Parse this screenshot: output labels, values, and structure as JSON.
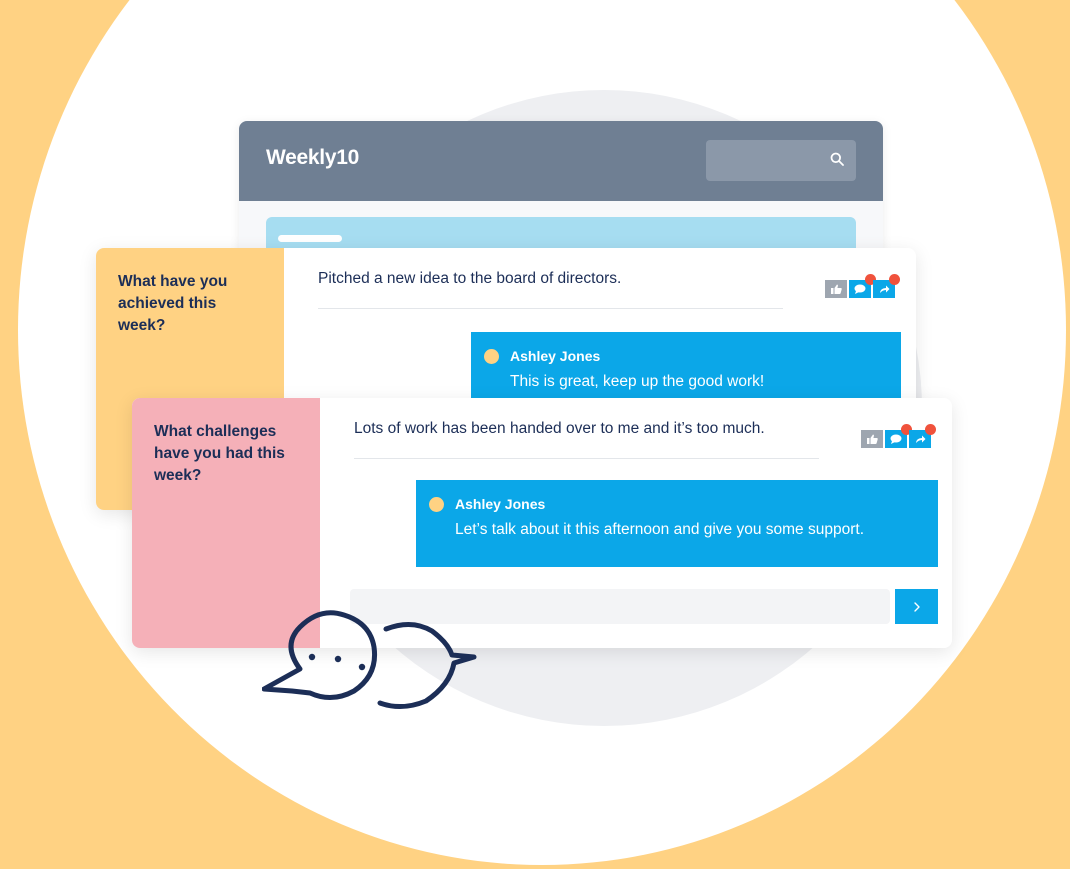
{
  "app": {
    "logo": "Weekly10",
    "search_icon": "search-icon"
  },
  "cards": [
    {
      "question": "What have you achieved this week?",
      "answer": "Pitched a new idea to the board of directors.",
      "reply": {
        "author": "Ashley Jones",
        "message": "This is great, keep up the good work!"
      }
    },
    {
      "question": "What challenges have you had this week?",
      "answer": "Lots of work has been handed over to me and it’s too much.",
      "reply": {
        "author": "Ashley Jones",
        "message": "Let’s talk about it this afternoon and give you some support."
      },
      "reply_input_placeholder": "",
      "send_icon": "chevron-right-icon"
    }
  ],
  "icons": [
    "thumbs-up-icon",
    "comment-icon",
    "share-icon",
    "speech-bubbles-icon"
  ],
  "colors": {
    "background": "#FFD283",
    "accent": "#0BA7E8",
    "question_yellow": "#FFD283",
    "question_pink": "#F5B0B8",
    "notification": "#F0523C",
    "header": "#6F7F93",
    "text_dark": "#1C2E57"
  }
}
